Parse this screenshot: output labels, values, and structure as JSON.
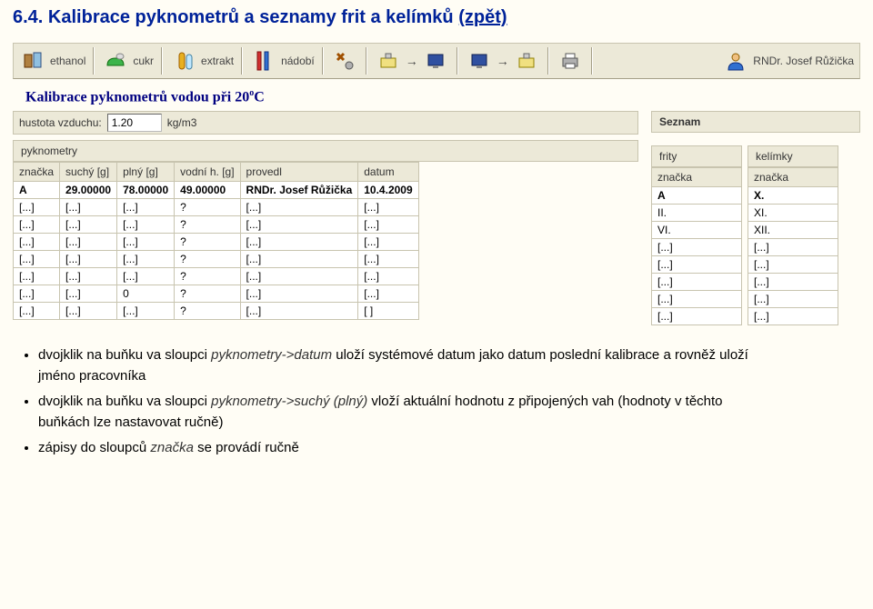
{
  "heading": {
    "text": "6.4. Kalibrace pyknometrů a seznamy frit a kelímků ",
    "link": "(zpět)"
  },
  "toolbar": {
    "ethanol": "ethanol",
    "cukr": "cukr",
    "extrakt": "extrakt",
    "nadobi": "nádobí",
    "user": "RNDr. Josef Růžička"
  },
  "sectionTitle": "Kalibrace pyknometrů vodou při 20 °C",
  "form": {
    "hustotaLabel": "hustota vzduchu:",
    "hustotaValue": "1.20",
    "hustotaUnit": "kg/m3"
  },
  "seznamLabel": "Seznam",
  "pyk": {
    "title": "pyknometry",
    "headers": [
      "značka",
      "suchý [g]",
      "plný [g]",
      "vodní h. [g]",
      "provedl",
      "datum"
    ],
    "rows": [
      [
        "A",
        "29.00000",
        "78.00000",
        "49.00000",
        "RNDr. Josef Růžička",
        "10.4.2009"
      ],
      [
        "[...]",
        "[...]",
        "[...]",
        "?",
        "[...]",
        "[...]"
      ],
      [
        "[...]",
        "[...]",
        "[...]",
        "?",
        "[...]",
        "[...]"
      ],
      [
        "[...]",
        "[...]",
        "[...]",
        "?",
        "[...]",
        "[...]"
      ],
      [
        "[...]",
        "[...]",
        "[...]",
        "?",
        "[...]",
        "[...]"
      ],
      [
        "[...]",
        "[...]",
        "[...]",
        "?",
        "[...]",
        "[...]"
      ],
      [
        "[...]",
        "[...]",
        "0",
        "?",
        "[...]",
        "[...]"
      ],
      [
        "[...]",
        "[...]",
        "[...]",
        "?",
        "[...]",
        "[ ]"
      ]
    ]
  },
  "frity": {
    "title": "frity",
    "header": "značka",
    "rows": [
      "A",
      "II.",
      "VI.",
      "[...]",
      "[...]",
      "[...]",
      "[...]",
      "[...]"
    ]
  },
  "kelimky": {
    "title": "kelímky",
    "header": "značka",
    "rows": [
      "X.",
      "XI.",
      "XII.",
      "[...]",
      "[...]",
      "[...]",
      "[...]",
      "[...]"
    ]
  },
  "bullets": {
    "b1a": "dvojklik na buňku va sloupci ",
    "b1b": "pyknometry->datum",
    "b1c": " uloží systémové datum jako datum poslední kalibrace a rovněž uloží jméno pracovníka",
    "b2a": "dvojklik na buňku va sloupci ",
    "b2b": "pyknometry->suchý (plný)",
    "b2c": " vloží aktuální hodnotu z připojených vah (hodnoty v těchto buňkách lze nastavovat ručně)",
    "b3a": "zápisy do sloupců ",
    "b3b": "značka",
    "b3c": " se provádí ručně"
  }
}
